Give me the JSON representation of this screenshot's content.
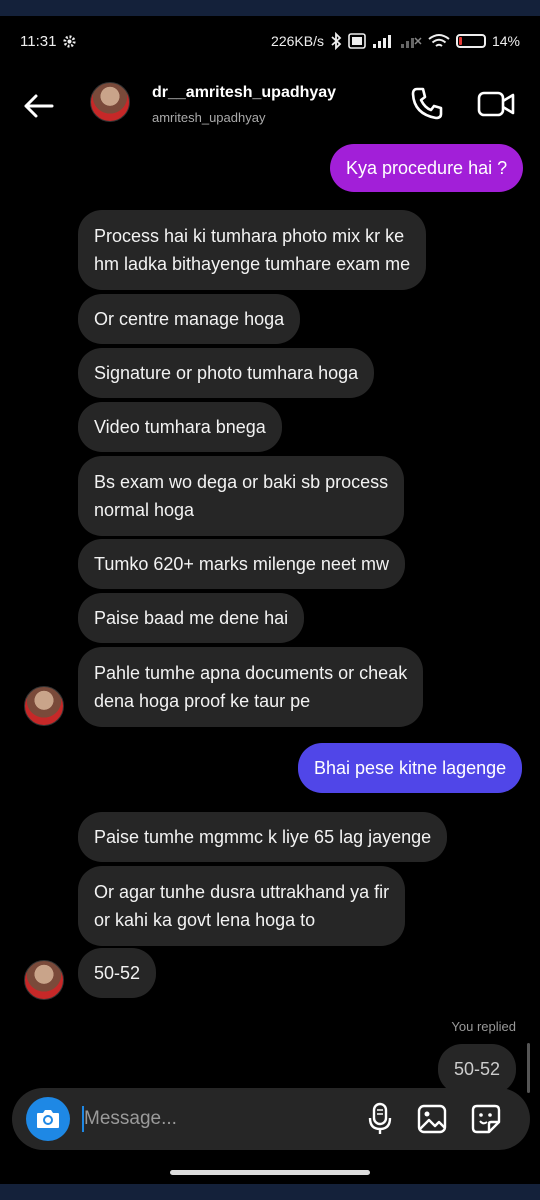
{
  "status": {
    "time": "11:31",
    "speed": "226KB/s",
    "battery": "14%",
    "battery_level": 0.14
  },
  "header": {
    "username": "dr__amritesh_upadhyay",
    "handle": "amritesh_upadhyay"
  },
  "messages": [
    {
      "from": "me",
      "text": "Kya procedure hai ?"
    },
    {
      "from": "them",
      "lines": [
        "Process hai ki tumhara photo mix kr ke",
        "hm ladka bithayenge tumhare exam me"
      ]
    },
    {
      "from": "them",
      "lines": [
        "Or centre manage hoga"
      ]
    },
    {
      "from": "them",
      "lines": [
        "Signature or photo tumhara hoga"
      ]
    },
    {
      "from": "them",
      "lines": [
        "Video tumhara bnega"
      ]
    },
    {
      "from": "them",
      "lines": [
        "Bs exam wo dega or baki sb process",
        "normal hoga"
      ]
    },
    {
      "from": "them",
      "lines": [
        "Tumko 620+ marks milenge neet mw"
      ]
    },
    {
      "from": "them",
      "lines": [
        "Paise baad me dene hai"
      ]
    },
    {
      "from": "them",
      "lines": [
        "Pahle tumhe apna documents or cheak",
        "dena hoga proof ke taur pe"
      ]
    },
    {
      "from": "me",
      "text": "Bhai pese kitne lagenge"
    },
    {
      "from": "them",
      "lines": [
        "Paise tumhe mgmmc k liye 65 lag jayenge"
      ]
    },
    {
      "from": "them",
      "lines": [
        "Or agar tunhe dusra uttrakhand ya fir",
        "or kahi ka govt lena hoga to"
      ]
    },
    {
      "from": "them",
      "lines": [
        "50-52"
      ]
    }
  ],
  "reply": {
    "label": "You replied",
    "text": "50-52"
  },
  "composer": {
    "placeholder": "Message..."
  },
  "colors": {
    "outgoing_1": "#a21fd8",
    "outgoing_2": "#5046e8",
    "incoming": "#262626",
    "camera": "#1e88e5"
  }
}
